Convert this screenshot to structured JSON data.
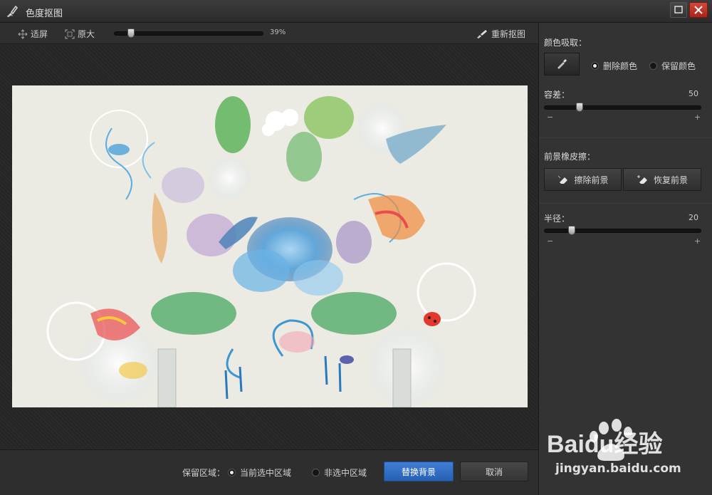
{
  "window": {
    "title": "色度抠图"
  },
  "toolbar": {
    "fit_label": "适屏",
    "original_label": "原大",
    "zoom_value": "39%",
    "zoom_level": 0.09,
    "redo_label": "重新抠图"
  },
  "panel": {
    "color_pick_title": "颜色吸取：",
    "delete_color_label": "删除颜色",
    "keep_color_label": "保留颜色",
    "selected_mode": "delete",
    "tolerance_title": "容差：",
    "tolerance_value": "50",
    "tolerance_level": 0.21,
    "eraser_title": "前景橡皮擦：",
    "erase_fg_label": "擦除前景",
    "restore_fg_label": "恢复前景",
    "radius_title": "半径：",
    "radius_value": "20",
    "radius_level": 0.16,
    "minus": "−",
    "plus": "+"
  },
  "bottom": {
    "keep_area_label": "保留区域：",
    "current_selection_label": "当前选中区域",
    "non_selection_label": "非选中区域",
    "replace_bg_label": "替换背景",
    "cancel_label": "取消"
  },
  "watermark": {
    "brand": "Baidu经验",
    "url": "jingyan.baidu.com"
  },
  "colors": {
    "accent": "#2f6fc4",
    "close": "#c0392b",
    "bg": "#2a2a2a"
  }
}
